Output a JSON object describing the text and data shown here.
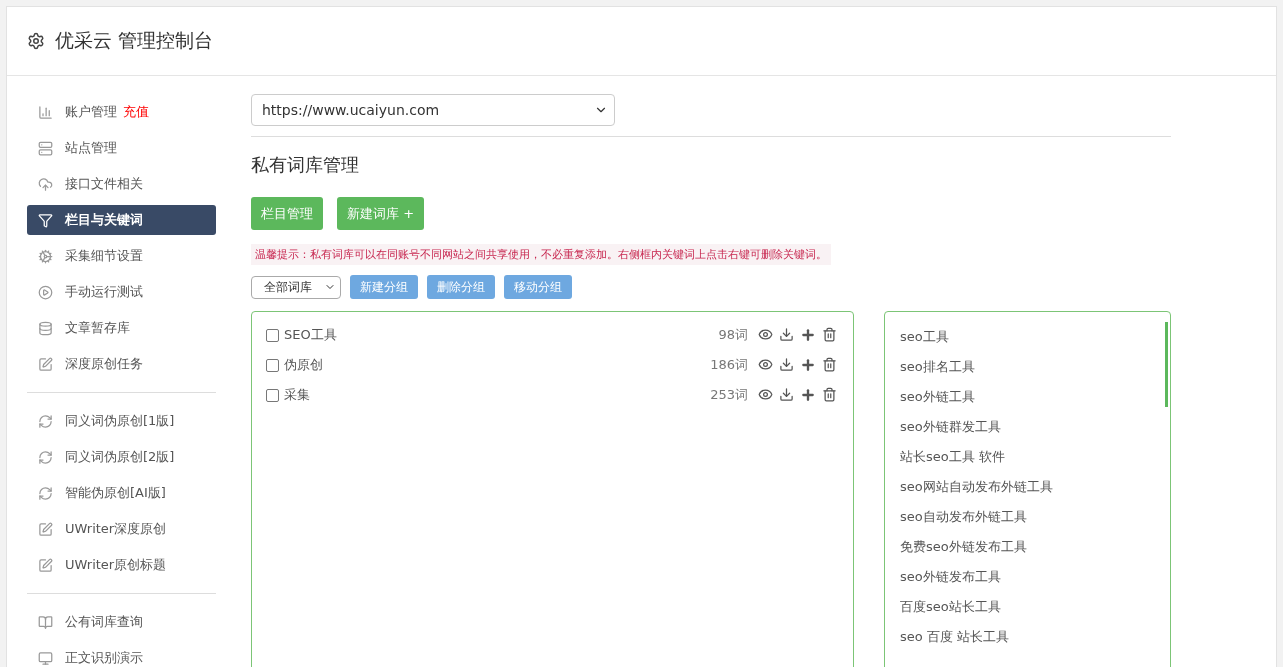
{
  "header": {
    "title": "优采云 管理控制台"
  },
  "sidebar": {
    "groups": [
      [
        {
          "label": "账户管理",
          "badge": "充值",
          "selected": false
        },
        {
          "label": "站点管理",
          "selected": false
        },
        {
          "label": "接口文件相关",
          "selected": false
        },
        {
          "label": "栏目与关键词",
          "selected": true
        },
        {
          "label": "采集细节设置",
          "selected": false
        },
        {
          "label": "手动运行测试",
          "selected": false
        },
        {
          "label": "文章暂存库",
          "selected": false
        },
        {
          "label": "深度原创任务",
          "selected": false
        }
      ],
      [
        {
          "label": "同义词伪原创[1版]",
          "selected": false
        },
        {
          "label": "同义词伪原创[2版]",
          "selected": false
        },
        {
          "label": "智能伪原创[AI版]",
          "selected": false
        },
        {
          "label": "UWriter深度原创",
          "selected": false
        },
        {
          "label": "UWriter原创标题",
          "selected": false
        }
      ],
      [
        {
          "label": "公有词库查询",
          "selected": false
        },
        {
          "label": "正文识别演示",
          "selected": false
        }
      ]
    ]
  },
  "site_select": {
    "value": "https://www.ucaiyun.com"
  },
  "section_title": "私有词库管理",
  "primary_buttons": [
    "栏目管理",
    "新建词库 +"
  ],
  "hint": "温馨提示：私有词库可以在同账号不同网站之间共享使用，不必重复添加。右侧框内关键词上点击右键可删除关键词。",
  "group_filter": {
    "value": "全部词库"
  },
  "group_buttons": [
    "新建分组",
    "删除分组",
    "移动分组"
  ],
  "libraries": [
    {
      "name": "SEO工具",
      "count": "98词",
      "checked": false
    },
    {
      "name": "伪原创",
      "count": "186词",
      "checked": false
    },
    {
      "name": "采集",
      "count": "253词",
      "checked": false
    }
  ],
  "keywords": [
    "seo工具",
    "seo排名工具",
    "seo外链工具",
    "seo外链群发工具",
    "站长seo工具 软件",
    "seo网站自动发布外链工具",
    "seo自动发布外链工具",
    "免费seo外链发布工具",
    "seo外链发布工具",
    "百度seo站长工具",
    "seo 百度 站长工具"
  ]
}
